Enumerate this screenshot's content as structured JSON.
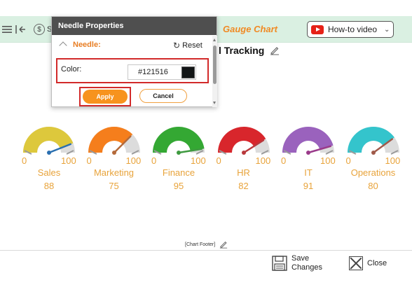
{
  "toolbar": {
    "menu_icon": "hamburger-icon",
    "back_icon": "back-arrow-icon",
    "dollar_icon": "dollar-circle-icon",
    "dollar_label": "S",
    "app_title": "Gauge Chart",
    "howto_label": "How-to video",
    "howto_icon": "youtube-icon"
  },
  "chart": {
    "title": "l Tracking",
    "footer": "[Chart Footer]"
  },
  "popup": {
    "title": "Needle Properties",
    "section_label": "Needle:",
    "reset_label": "Reset",
    "color_label": "Color:",
    "color_hex": "#121516",
    "apply_label": "Apply",
    "cancel_label": "Cancel"
  },
  "actions": {
    "save_label_1": "Save",
    "save_label_2": "Changes",
    "close_label": "Close"
  },
  "colors": {
    "accent": "#f7931e",
    "label": "#e8a33a",
    "needle": "#121516",
    "highlight": "#d22a2a",
    "topbar": "#daf0e2"
  },
  "chart_data": {
    "type": "gauge",
    "min": 0,
    "max": 100,
    "gauges": [
      {
        "name": "Sales",
        "value": 88,
        "color": "#ddc83c",
        "needle": "#2a6fb0"
      },
      {
        "name": "Marketing",
        "value": 75,
        "color": "#f57e1c",
        "needle": "#b46a3a"
      },
      {
        "name": "Finance",
        "value": 95,
        "color": "#34a833",
        "needle": "#3f9a40"
      },
      {
        "name": "HR",
        "value": 82,
        "color": "#d8262c",
        "needle": "#b9383c"
      },
      {
        "name": "IT",
        "value": 91,
        "color": "#9a62bd",
        "needle": "#9a3a8a"
      },
      {
        "name": "Operations",
        "value": 80,
        "color": "#34c4cc",
        "needle": "#a05a4a"
      }
    ],
    "min_label": "0",
    "max_label": "100"
  }
}
